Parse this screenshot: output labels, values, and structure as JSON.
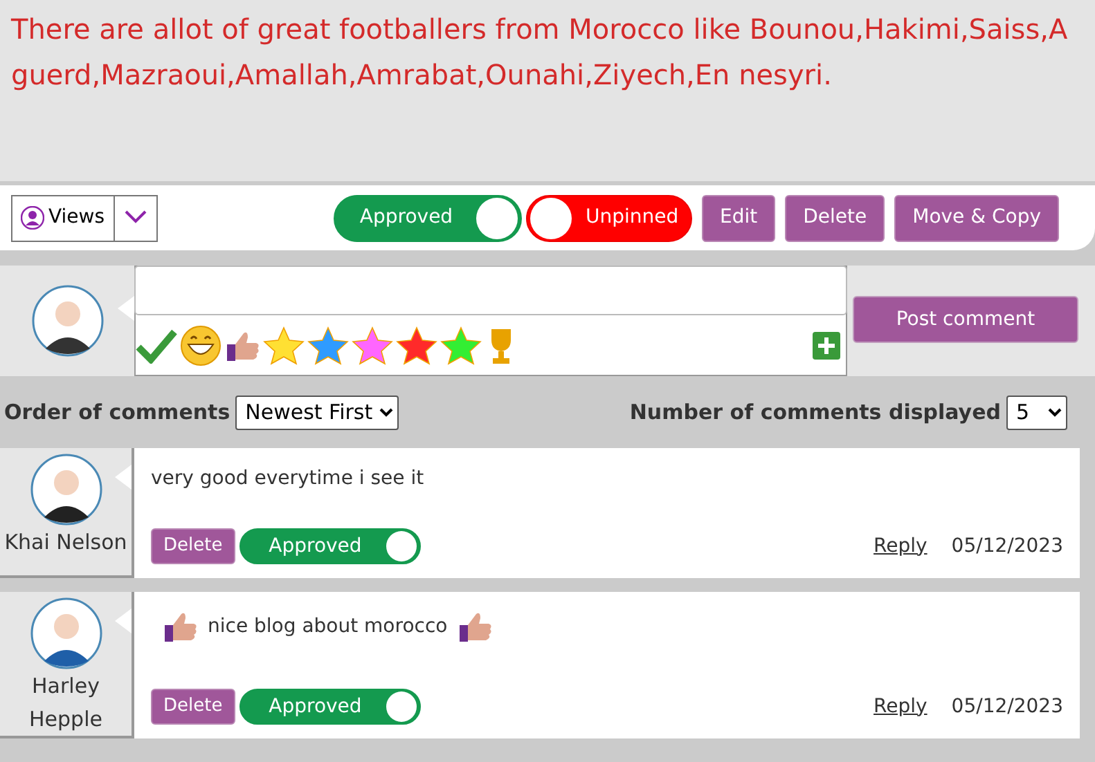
{
  "post": {
    "text": "There are allot of great footballers from Morocco like Bounou,Hakimi,Saiss,Aguerd,Mazraoui,Amallah,Amrabat,Ounahi,Ziyech,En nesyri."
  },
  "toolbar": {
    "views": "Views",
    "approved": {
      "label": "Approved",
      "on": true
    },
    "pinned": {
      "label": "Unpinned",
      "on": false
    },
    "buttons": [
      "Edit",
      "Delete",
      "Move & Copy"
    ]
  },
  "composer": {
    "reactions": [
      {
        "kind": "check"
      },
      {
        "kind": "grin"
      },
      {
        "kind": "thumb"
      },
      {
        "kind": "star",
        "color": "#ffe033"
      },
      {
        "kind": "star",
        "color": "#2f9bff"
      },
      {
        "kind": "star",
        "color": "#ff66ff"
      },
      {
        "kind": "star",
        "color": "#ff2a2a"
      },
      {
        "kind": "star",
        "color": "#33ee33"
      },
      {
        "kind": "trophy"
      }
    ],
    "post_button": "Post comment"
  },
  "order": {
    "label": "Order of comments",
    "value": "Newest First"
  },
  "count": {
    "label": "Number of comments displayed",
    "value": "5"
  },
  "comments": [
    {
      "author": "Khai Nelson",
      "text": "very good everytime i see it",
      "thumbs": false,
      "delete": "Delete",
      "approved": {
        "label": "Approved",
        "on": true
      },
      "reply": "Reply",
      "date": "05/12/2023"
    },
    {
      "author": "Harley Hepple",
      "text": "nice blog about morocco",
      "thumbs": true,
      "delete": "Delete",
      "approved": {
        "label": "Approved",
        "on": true
      },
      "reply": "Reply",
      "date": "05/12/2023"
    }
  ]
}
